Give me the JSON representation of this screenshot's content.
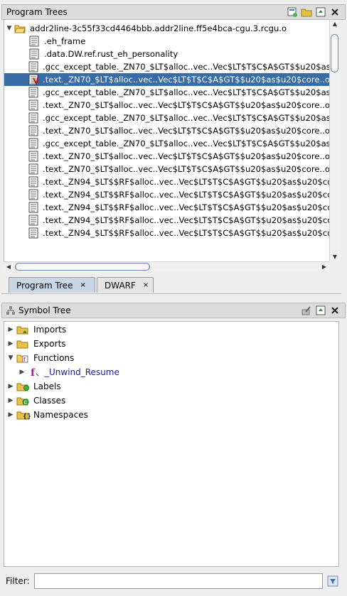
{
  "program_trees": {
    "title": "Program Trees",
    "root": "addr2line-3c55f33cd4464bbb.addr2line.ff5e4bca-cgu.3.rcgu.o",
    "items": [
      ".eh_frame",
      ".data.DW.ref.rust_eh_personality",
      ".gcc_except_table._ZN70_$LT$alloc..vec..Vec$LT$T$C$A$GT$$u20$as",
      ".text._ZN70_$LT$alloc..vec..Vec$LT$T$C$A$GT$$u20$as$u20$core..o",
      ".gcc_except_table._ZN70_$LT$alloc..vec..Vec$LT$T$C$A$GT$$u20$as",
      ".text._ZN70_$LT$alloc..vec..Vec$LT$T$C$A$GT$$u20$as$u20$core..o",
      ".gcc_except_table._ZN70_$LT$alloc..vec..Vec$LT$T$C$A$GT$$u20$as",
      ".text._ZN70_$LT$alloc..vec..Vec$LT$T$C$A$GT$$u20$as$u20$core..o",
      ".gcc_except_table._ZN70_$LT$alloc..vec..Vec$LT$T$C$A$GT$$u20$as",
      ".text._ZN70_$LT$alloc..vec..Vec$LT$T$C$A$GT$$u20$as$u20$core..o",
      ".text._ZN70_$LT$alloc..vec..Vec$LT$T$C$A$GT$$u20$as$u20$core..o",
      ".text._ZN94_$LT$$RF$alloc..vec..Vec$LT$T$C$A$GT$$u20$as$u20$co",
      ".text._ZN94_$LT$$RF$alloc..vec..Vec$LT$T$C$A$GT$$u20$as$u20$co",
      ".text._ZN94_$LT$$RF$alloc..vec..Vec$LT$T$C$A$GT$$u20$as$u20$co",
      ".text._ZN94_$LT$$RF$alloc..vec..Vec$LT$T$C$A$GT$$u20$as$u20$co",
      ".text._ZN94_$LT$$RF$alloc..vec..Vec$LT$T$C$A$GT$$u20$as$u20$co"
    ],
    "selected_index": 3,
    "tabs": [
      {
        "label": "Program Tree",
        "close": "×"
      },
      {
        "label": "DWARF",
        "close": "×"
      }
    ]
  },
  "symbol_tree": {
    "title": "Symbol Tree",
    "items": [
      {
        "label": "Imports"
      },
      {
        "label": "Exports"
      },
      {
        "label": "Functions"
      },
      {
        "label": "_Unwind_Resume"
      },
      {
        "label": "Labels"
      },
      {
        "label": "Classes"
      },
      {
        "label": "Namespaces"
      }
    ]
  },
  "filter": {
    "label": "Filter:",
    "value": ""
  },
  "colors": {
    "selection": "#386ca6",
    "function_link": "#1a1aa6",
    "folder": "#e8c04a"
  }
}
